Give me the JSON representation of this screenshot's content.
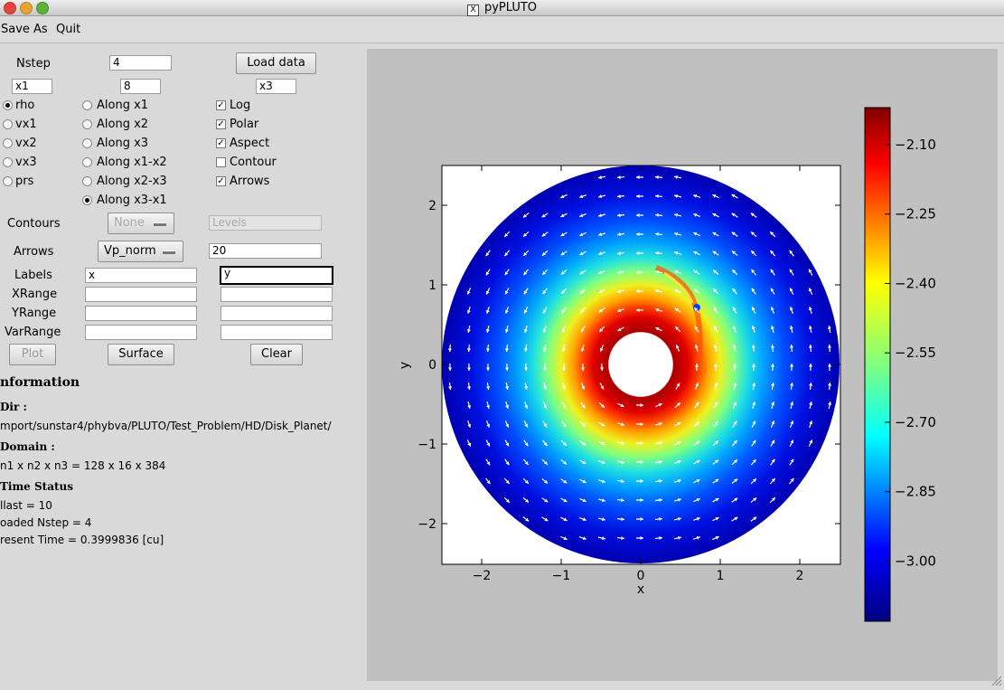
{
  "window": {
    "title": "pyPLUTO"
  },
  "menu": {
    "items": [
      "Save As",
      "Quit"
    ]
  },
  "controls": {
    "nstep_label": "Nstep",
    "nstep_value": "4",
    "load_data": "Load data",
    "x1_value": "x1",
    "mid_value": "8",
    "x3_value": "x3",
    "variables": [
      {
        "label": "rho",
        "selected": true
      },
      {
        "label": "vx1",
        "selected": false
      },
      {
        "label": "vx2",
        "selected": false
      },
      {
        "label": "vx3",
        "selected": false
      },
      {
        "label": "prs",
        "selected": false
      }
    ],
    "slices": [
      {
        "label": "Along x1",
        "selected": false
      },
      {
        "label": "Along x2",
        "selected": false
      },
      {
        "label": "Along x3",
        "selected": false
      },
      {
        "label": "Along x1-x2",
        "selected": false
      },
      {
        "label": "Along x2-x3",
        "selected": false
      },
      {
        "label": "Along x3-x1",
        "selected": true
      }
    ],
    "options": [
      {
        "label": "Log",
        "checked": true
      },
      {
        "label": "Polar",
        "checked": true
      },
      {
        "label": "Aspect",
        "checked": true
      },
      {
        "label": "Contour",
        "checked": false
      },
      {
        "label": "Arrows",
        "checked": true
      }
    ],
    "contours_label": "Contours",
    "contours_select": "None",
    "levels_placeholder": "Levels",
    "arrows_label": "Arrows",
    "arrows_select": "Vp_norm",
    "arrows_value": "20",
    "labels_label": "Labels",
    "labels_x": "x",
    "labels_y": "y",
    "xrange_label": "XRange",
    "yrange_label": "YRange",
    "varrange_label": "VarRange",
    "plot_button": "Plot",
    "surface_button": "Surface",
    "clear_button": "Clear"
  },
  "information": {
    "heading": "nformation",
    "dir_heading": "Dir :",
    "dir_value": "mport/sunstar4/phybva/PLUTO/Test_Problem/HD/Disk_Planet/",
    "domain_heading": "Domain :",
    "domain_value": "n1 x n2 x n3 =  128 x 16 x 384",
    "time_heading": "Time Status",
    "nlast": "llast = 10",
    "loaded": "oaded Nstep = 4",
    "present": "resent Time = 0.3999836 [cu]"
  },
  "plot": {
    "xlabel": "x",
    "ylabel": "y",
    "xticks": [
      "−2",
      "−1",
      "0",
      "1",
      "2"
    ],
    "yticks": [
      "2",
      "1",
      "0",
      "−1",
      "−2"
    ],
    "colorbar_ticks": [
      "−2.10",
      "−2.25",
      "−2.40",
      "−2.55",
      "−2.70",
      "−2.85",
      "−3.00"
    ]
  },
  "chart_data": {
    "type": "heatmap",
    "description_type": "polar density map with velocity arrows",
    "xlabel": "x",
    "ylabel": "y",
    "xlim": [
      -2.5,
      2.5
    ],
    "ylim": [
      -2.5,
      2.5
    ],
    "xticks": [
      -2,
      -1,
      0,
      1,
      2
    ],
    "yticks": [
      -2,
      -1,
      0,
      1,
      2
    ],
    "inner_radius": 0.4,
    "outer_radius": 2.5,
    "colorbar": {
      "min": -3.13,
      "max": -2.02,
      "ticks": [
        -2.1,
        -2.25,
        -2.4,
        -2.55,
        -2.7,
        -2.85,
        -3.0
      ],
      "colormap": "jet"
    },
    "planet_position": [
      0.7,
      0.9
    ]
  }
}
